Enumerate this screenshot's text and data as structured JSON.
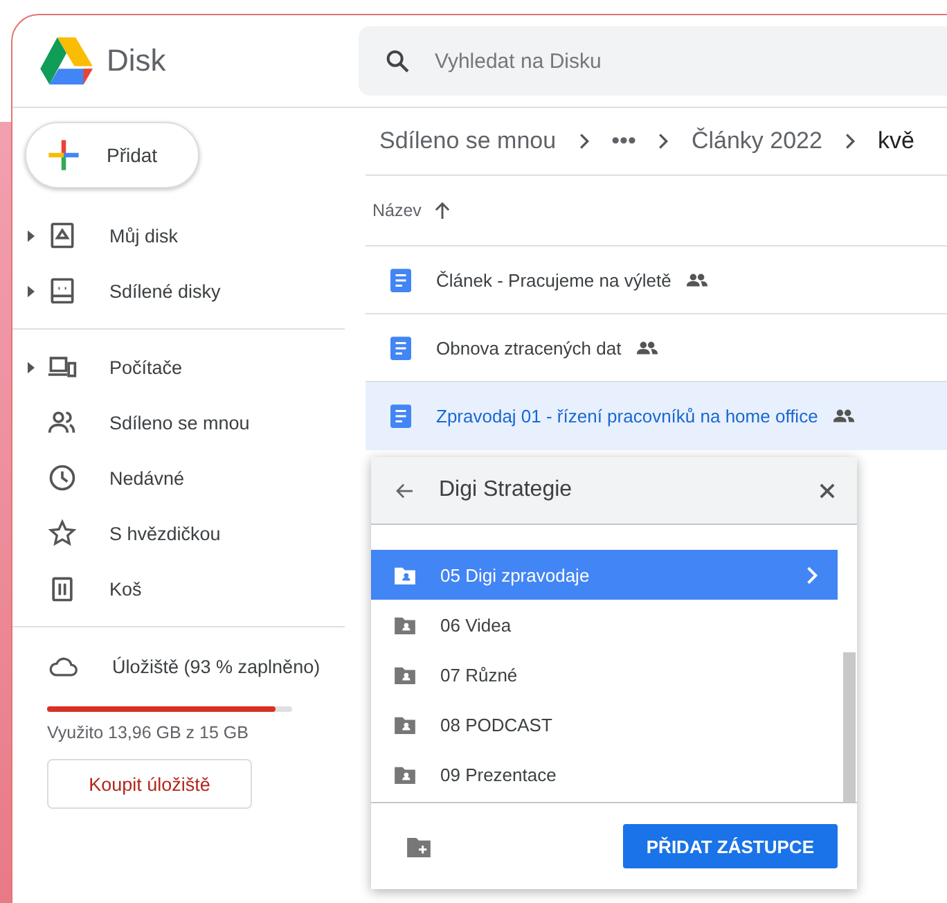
{
  "app": {
    "title": "Disk"
  },
  "search": {
    "placeholder": "Vyhledat na Disku"
  },
  "new_button": "Přidat",
  "sidebar": {
    "items": [
      {
        "label": "Můj disk",
        "expandable": true
      },
      {
        "label": "Sdílené disky",
        "expandable": true
      },
      {
        "label": "Počítače",
        "expandable": true
      },
      {
        "label": "Sdíleno se mnou",
        "expandable": false
      },
      {
        "label": "Nedávné",
        "expandable": false
      },
      {
        "label": "S hvězdičkou",
        "expandable": false
      },
      {
        "label": "Koš",
        "expandable": false
      }
    ],
    "storage": {
      "label": "Úložiště (93 % zaplněno)",
      "level": 0.93,
      "usage": "Využito 13,96 GB z 15 GB",
      "buy_button": "Koupit úložiště"
    }
  },
  "breadcrumb": [
    "Sdíleno se mnou",
    "•••",
    "Články 2022",
    "kvě"
  ],
  "table": {
    "column": "Název",
    "rows": [
      {
        "name": "Článek - Pracujeme na výletě",
        "shared": true,
        "selected": false
      },
      {
        "name": "Obnova ztracených dat",
        "shared": true,
        "selected": false
      },
      {
        "name": "Zpravodaj 01 - řízení pracovníků na home office",
        "shared": true,
        "selected": true
      }
    ]
  },
  "dialog": {
    "title": "Digi Strategie",
    "folders": [
      {
        "name": "05 Digi zpravodaje",
        "selected": true
      },
      {
        "name": "06 Videa",
        "selected": false
      },
      {
        "name": "07 Různé",
        "selected": false
      },
      {
        "name": "08 PODCAST",
        "selected": false
      },
      {
        "name": "09 Prezentace",
        "selected": false
      }
    ],
    "action_button": "PŘIDAT ZÁSTUPCE"
  }
}
